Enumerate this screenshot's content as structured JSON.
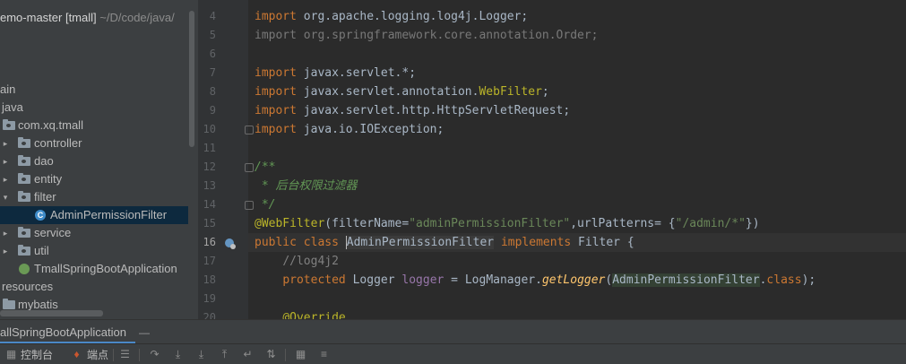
{
  "project": {
    "name": "emo-master [tmall]",
    "path": "~/D/code/java/"
  },
  "tree": [
    {
      "label": "ain",
      "kind": "text"
    },
    {
      "label": "java",
      "kind": "folder"
    },
    {
      "label": "com.xq.tmall",
      "kind": "package"
    },
    {
      "label": "controller",
      "kind": "package"
    },
    {
      "label": "dao",
      "kind": "package"
    },
    {
      "label": "entity",
      "kind": "package"
    },
    {
      "label": "filter",
      "kind": "package"
    },
    {
      "label": "AdminPermissionFilter",
      "kind": "class"
    },
    {
      "label": "service",
      "kind": "package"
    },
    {
      "label": "util",
      "kind": "package"
    },
    {
      "label": "TmallSpringBootApplication",
      "kind": "spring"
    },
    {
      "label": "resources",
      "kind": "folder"
    },
    {
      "label": "mybatis",
      "kind": "folder"
    }
  ],
  "editor": {
    "line_numbers": [
      "4",
      "5",
      "6",
      "7",
      "8",
      "9",
      "10",
      "11",
      "12",
      "13",
      "14",
      "15",
      "16",
      "17",
      "18",
      "19",
      "20"
    ],
    "current_line": "16",
    "lines": {
      "l4": {
        "kw": "import",
        "rest": " org.apache.logging.log4j.Logger;"
      },
      "l5": {
        "text": "import org.springframework.core.annotation.Order;"
      },
      "l7": {
        "kw": "import",
        "rest": " javax.servlet.*;"
      },
      "l8": {
        "kw": "import",
        "pre": " javax.servlet.annotation.",
        "ann": "WebFilter",
        "post": ";"
      },
      "l9": {
        "kw": "import",
        "rest": " javax.servlet.http.HttpServletRequest;"
      },
      "l10": {
        "kw": "import",
        "rest": " java.io.IOException;"
      },
      "l12": {
        "doc": "/**"
      },
      "l13": {
        "doc": " * 后台权限过滤器"
      },
      "l14": {
        "doc": " */"
      },
      "l15": {
        "ann": "@WebFilter",
        "a": "(filterName=",
        "s1": "\"adminPermissionFilter\"",
        "b": ",urlPatterns= {",
        "s2": "\"/admin/*\"",
        "c": "})"
      },
      "l16": {
        "kw1": "public class ",
        "cls": "AdminPermissionFilter",
        "kw2": " implements ",
        "rest": "Filter {"
      },
      "l17": {
        "cmt": "//log4j2"
      },
      "l18": {
        "kw": "protected ",
        "type": "Logger ",
        "fld": "logger",
        "eq": " = LogManager.",
        "stat": "getLogger",
        "p1": "(",
        "cls": "AdminPermissionFilter",
        "p2": ".",
        "kw2": "class",
        "p3": ");"
      },
      "l20": {
        "ann": "@Override"
      }
    }
  },
  "run_tab": {
    "label": "allSpringBootApplication",
    "close": "—"
  },
  "toolbar": {
    "console": "控制台",
    "breakpoints": "端点"
  },
  "colors": {
    "keyword": "#cc7832",
    "string": "#6a8759",
    "annotation": "#bbb529",
    "doc_comment": "#629755",
    "field": "#9876aa",
    "static_method": "#ffc66d",
    "selection": "#0d293e"
  }
}
